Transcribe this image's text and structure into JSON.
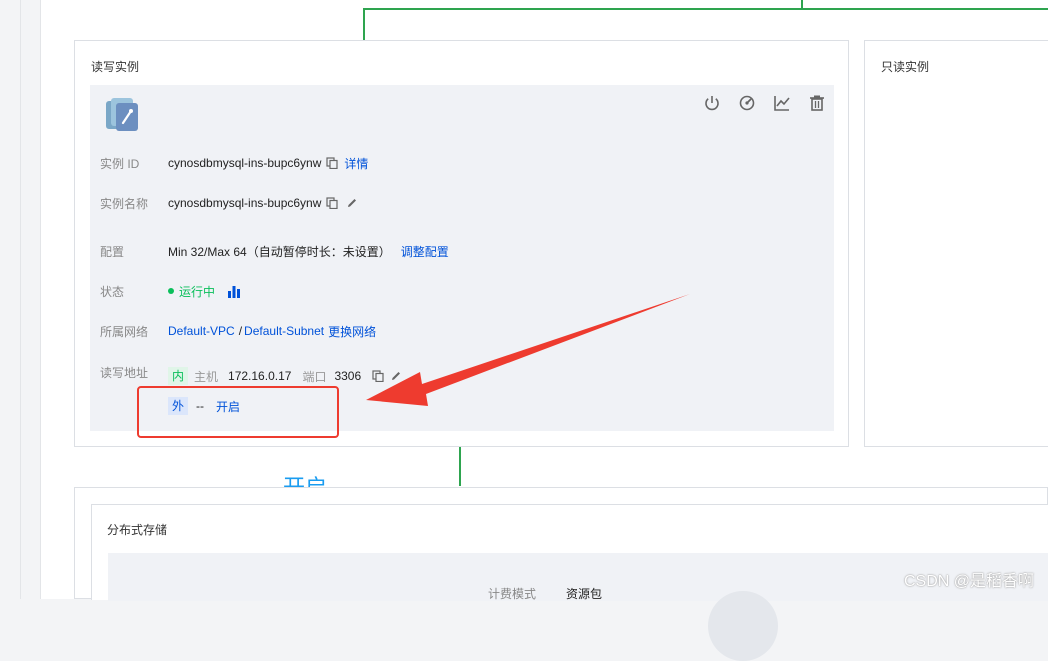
{
  "rw_card": {
    "title": "读写实例",
    "toolbar_icons": [
      "power-icon",
      "restart-icon",
      "monitor-chart-icon",
      "delete-icon"
    ],
    "rows": {
      "instance_id": {
        "label": "实例 ID",
        "value": "cynosdbmysql-ins-bupc6ynw",
        "link": "详情"
      },
      "instance_name": {
        "label": "实例名称",
        "value": "cynosdbmysql-ins-bupc6ynw"
      },
      "config": {
        "label": "配置",
        "value": "Min 32/Max 64（自动暂停时长：未设置）",
        "link": "调整配置"
      },
      "status": {
        "label": "状态",
        "value": "运行中"
      },
      "network": {
        "label": "所属网络",
        "vpc": "Default-VPC",
        "sep": "/",
        "subnet": "Default-Subnet",
        "link": "更换网络"
      },
      "rw_address": {
        "label": "读写地址",
        "internal": {
          "tag": "内",
          "host_label": "主机",
          "host": "172.16.0.17",
          "port_label": "端口",
          "port": "3306"
        },
        "external": {
          "tag": "外",
          "value": "--",
          "link": "开启"
        }
      }
    }
  },
  "ro_card": {
    "title": "只读实例"
  },
  "annotation": {
    "text": "开启"
  },
  "storage": {
    "title": "分布式存储",
    "billing_label": "计费模式",
    "billing_value": "资源包"
  },
  "watermark": "CSDN @是稻香啊",
  "colors": {
    "link": "#0052d9",
    "running": "#0abf5b",
    "annotation_red": "#ee3b2f",
    "annotation_blue": "#1a9cf0",
    "topology_line": "#2ea44f"
  }
}
